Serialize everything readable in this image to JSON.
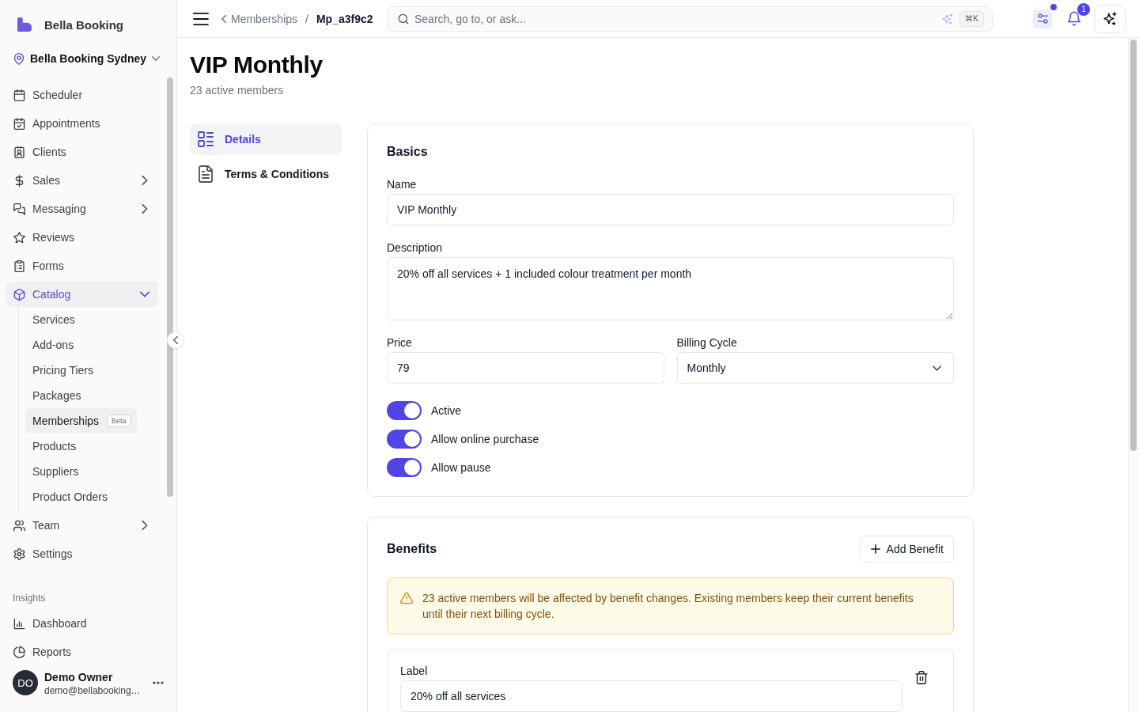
{
  "sidebar": {
    "brand": "Bella Booking",
    "location": "Bella Booking Sydney",
    "nav": [
      {
        "label": "Scheduler",
        "kind": "link",
        "selected": false
      },
      {
        "label": "Appointments",
        "kind": "link",
        "selected": false
      },
      {
        "label": "Clients",
        "kind": "link",
        "selected": false
      },
      {
        "label": "Sales",
        "kind": "group",
        "selected": false,
        "expanded": false
      },
      {
        "label": "Messaging",
        "kind": "group",
        "selected": false,
        "expanded": false
      },
      {
        "label": "Reviews",
        "kind": "link",
        "selected": false
      },
      {
        "label": "Forms",
        "kind": "link",
        "selected": false
      },
      {
        "label": "Catalog",
        "kind": "group",
        "selected": true,
        "expanded": true,
        "children": [
          {
            "label": "Services",
            "selected": false
          },
          {
            "label": "Add-ons",
            "selected": false
          },
          {
            "label": "Pricing Tiers",
            "selected": false
          },
          {
            "label": "Packages",
            "selected": false
          },
          {
            "label": "Memberships",
            "selected": true,
            "badge": "Beta"
          },
          {
            "label": "Products",
            "selected": false
          },
          {
            "label": "Suppliers",
            "selected": false
          },
          {
            "label": "Product Orders",
            "selected": false
          }
        ]
      },
      {
        "label": "Team",
        "kind": "group",
        "selected": false,
        "expanded": false
      },
      {
        "label": "Settings",
        "kind": "link",
        "selected": false
      }
    ],
    "sections": [
      {
        "heading": "Insights",
        "items": [
          {
            "label": "Dashboard",
            "selected": false
          },
          {
            "label": "Reports",
            "selected": false
          }
        ]
      }
    ],
    "user": {
      "initials": "DO",
      "name": "Demo Owner",
      "email": "demo@bellabooking…"
    }
  },
  "topbar": {
    "breadcrumbs": [
      {
        "label": "Memberships"
      },
      {
        "label": "Mp_a3f9c2"
      }
    ],
    "separator": "/",
    "search": {
      "placeholder": "Search, go to, or ask...",
      "shortcut": "⌘K"
    },
    "filters_active": true,
    "notification_count": "1"
  },
  "page": {
    "title": "VIP Monthly",
    "subtitle": "23 active members",
    "tabs": [
      {
        "label": "Details",
        "selected": true
      },
      {
        "label": "Terms & Conditions",
        "selected": false
      }
    ]
  },
  "basics": {
    "title": "Basics",
    "name": {
      "label": "Name",
      "value": "VIP Monthly"
    },
    "description": {
      "label": "Description",
      "value": "20% off all services + 1 included colour treatment per month"
    },
    "price": {
      "label": "Price",
      "value": "79"
    },
    "billing_cycle": {
      "label": "Billing Cycle",
      "value": "Monthly"
    },
    "toggles": [
      {
        "label": "Active",
        "on": true
      },
      {
        "label": "Allow online purchase",
        "on": true
      },
      {
        "label": "Allow pause",
        "on": true
      }
    ]
  },
  "benefits": {
    "title": "Benefits",
    "add_button": "Add Benefit",
    "notice": "23 active members will be affected by benefit changes. Existing members keep their current benefits until their next billing cycle.",
    "items": [
      {
        "field_label": "Label",
        "value": "20% off all services"
      }
    ]
  }
}
